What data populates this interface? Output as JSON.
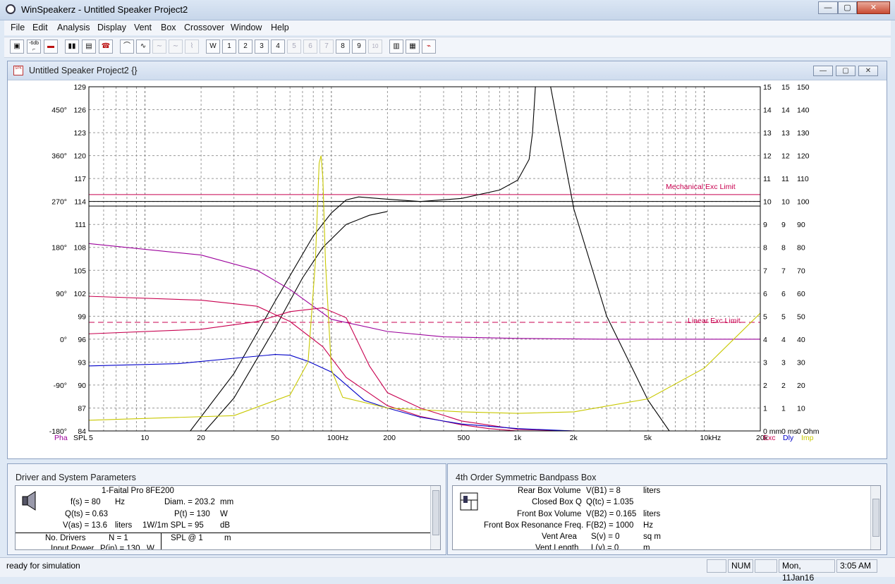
{
  "window": {
    "title": "WinSpeakerz - Untitled Speaker Project2",
    "min": "—",
    "max": "▢",
    "close": "✕"
  },
  "menu": [
    "File",
    "Edit",
    "Analysis",
    "Display",
    "Vent",
    "Box",
    "Crossover",
    "Window",
    "Help"
  ],
  "toolbar": {
    "b2": "-6db",
    "w": "W",
    "n1": "1",
    "n2": "2",
    "n3": "3",
    "n4": "4",
    "n5": "5",
    "n6": "6",
    "n7": "7",
    "n8": "8",
    "n9": "9",
    "n10": "10"
  },
  "icons": [
    "driver-icon",
    "step-icon",
    "car-icon",
    "bars-icon",
    "speaker-icon",
    "phone-icon",
    "curve1-icon",
    "curve2-icon",
    "curve3-icon",
    "curve4-icon",
    "curve5-icon",
    "graph-icon",
    "print-icon",
    "scope-icon"
  ],
  "child": {
    "title": "Untitled Speaker Project2 {}",
    "icon_text": "SPK",
    "min": "—",
    "max": "▢",
    "close": "✕"
  },
  "chart_data": {
    "type": "line",
    "x_scale": "log",
    "xlim": [
      5,
      20000
    ],
    "x_ticks": [
      "5",
      "10",
      "20",
      "50",
      "100Hz",
      "200",
      "500",
      "1k",
      "2k",
      "5k",
      "10kHz",
      "20k"
    ],
    "spl_ticks": [
      "129",
      "126",
      "123",
      "120",
      "117",
      "114",
      "111",
      "108",
      "105",
      "102",
      "99",
      "96",
      "93",
      "90",
      "87",
      "84"
    ],
    "phase_ticks": [
      "450°",
      "360°",
      "270°",
      "180°",
      "90°",
      "0°",
      "-90°",
      "-180°"
    ],
    "right_ticks_exc": [
      "15",
      "14",
      "13",
      "12",
      "11",
      "10",
      "9",
      "8",
      "7",
      "6",
      "5",
      "4",
      "3",
      "2",
      "1",
      "0 mm"
    ],
    "right_ticks_dly": [
      "15",
      "14",
      "13",
      "12",
      "11",
      "10",
      "9",
      "8",
      "7",
      "6",
      "5",
      "4",
      "3",
      "2",
      "1",
      "0 ms"
    ],
    "right_ticks_imp": [
      "150",
      "140",
      "130",
      "120",
      "110",
      "100",
      "90",
      "80",
      "70",
      "60",
      "50",
      "40",
      "30",
      "20",
      "10",
      "0 Ohm"
    ],
    "axis_labels": {
      "pha": "Pha",
      "spl": "SPL",
      "exc": "Exc",
      "dly": "Dly",
      "imp": "Imp"
    },
    "annotations": {
      "mech": "Mechanical Exc Limit",
      "lin": "Linear Exc Limit"
    },
    "colors": {
      "spl": "#000000",
      "pha": "#9b009b",
      "exc": "#c8004f",
      "dly": "#0000c8",
      "imp": "#c8c800",
      "limit": "#c8004f"
    },
    "series": [
      {
        "id": "spl_a",
        "color": "#000000",
        "x": [
          17.5,
          30,
          50,
          80,
          100,
          120,
          140,
          200,
          300,
          500,
          800,
          1000,
          1150,
          1200,
          1250,
          1300,
          1500,
          2000,
          3000,
          5000,
          6500
        ],
        "y": [
          84,
          91.5,
          101,
          109.5,
          112.5,
          114.2,
          114.6,
          114.3,
          114.0,
          114.4,
          115.5,
          116.8,
          119.5,
          123,
          130,
          133,
          129,
          113,
          99,
          88,
          84
        ]
      },
      {
        "id": "spl_b",
        "color": "#000000",
        "x": [
          21,
          30,
          50,
          70,
          90,
          120,
          160,
          200
        ],
        "y": [
          84,
          88.3,
          97.5,
          104,
          108,
          111,
          112.2,
          112.7
        ]
      },
      {
        "id": "phase",
        "color": "#9b009b",
        "x": [
          5,
          20,
          40,
          60,
          100,
          200,
          400,
          1000,
          3000,
          20000
        ],
        "y": [
          108.5,
          107,
          105,
          102.5,
          98.6,
          97,
          96.3,
          96.1,
          96,
          96
        ]
      },
      {
        "id": "exc",
        "color": "#c8004f",
        "x": [
          5,
          20,
          40,
          60,
          90,
          120,
          160,
          200,
          300,
          500,
          1000,
          2000
        ],
        "y": [
          96.7,
          97.3,
          98.3,
          99.6,
          100.1,
          98.8,
          92.5,
          89,
          87,
          85.3,
          84.2,
          84
        ]
      },
      {
        "id": "exc_b",
        "color": "#c8004f",
        "x": [
          5,
          20,
          40,
          60,
          90,
          120,
          200,
          300,
          500,
          700,
          1000
        ],
        "y": [
          101.6,
          101.1,
          100.3,
          98.3,
          95,
          91,
          87.3,
          85.9,
          84.8,
          84.3,
          84
        ]
      },
      {
        "id": "dly",
        "color": "#0000c8",
        "x": [
          5,
          15,
          30,
          50,
          60,
          75,
          100,
          150,
          200,
          300,
          500,
          1000,
          2000
        ],
        "y": [
          92.5,
          92.8,
          93.5,
          94.0,
          93.9,
          93.1,
          91.7,
          88,
          87,
          85.8,
          84.9,
          84.3,
          84
        ]
      },
      {
        "id": "imp",
        "color": "#c8c800",
        "x": [
          5,
          30,
          60,
          75,
          82,
          86,
          88,
          90,
          93,
          100,
          115,
          200,
          500,
          1000,
          2000,
          5000,
          10000,
          20000
        ],
        "y": [
          85.4,
          86.0,
          88.7,
          93,
          106,
          119,
          120,
          117,
          106,
          92,
          88.4,
          87.0,
          86.5,
          86.3,
          86.5,
          88.2,
          92.2,
          99.4
        ]
      }
    ],
    "hlines": [
      {
        "y": 114.0,
        "color": "#000000",
        "style": "solid",
        "x_to": 20000
      },
      {
        "y": 113.4,
        "color": "#000000",
        "style": "solid",
        "x_to": 20000
      },
      {
        "y": 114.9,
        "color": "#c8004f",
        "style": "solid",
        "x_to": 20000
      },
      {
        "y": 98.2,
        "color": "#c8004f",
        "style": "dashed",
        "x_to": 20000
      }
    ],
    "grid": true
  },
  "driver_panel": {
    "title": "Driver and System Parameters",
    "driver": "1-Faital Pro 8FE200",
    "rows": [
      {
        "a": "f(s) = 80",
        "b": "Hz",
        "c": "Diam. = 203.2",
        "d": "mm"
      },
      {
        "a": "Q(ts) = 0.63",
        "b": "",
        "c": "P(t) = 130",
        "d": "W"
      },
      {
        "a": "V(as) = 13.6",
        "b": "liters",
        "c": "1W/1m SPL = 95",
        "d": "dB"
      }
    ],
    "nd_label": "No. Drivers",
    "nd_value": "N = 1",
    "spl1": "SPL @ 1",
    "spl1_unit": "m",
    "ip_label": "Input Power",
    "ip_value": "P(in) = 130",
    "ip_unit": "W"
  },
  "box_panel": {
    "title": "4th Order Symmetric Bandpass Box",
    "rows": [
      {
        "a": "Rear Box Volume",
        "b": "V(B1) = 8",
        "c": "liters"
      },
      {
        "a": "Closed Box Q",
        "b": "Q(tc) = 1.035",
        "c": ""
      },
      {
        "a": "Front Box Volume",
        "b": "V(B2) = 0.165",
        "c": "liters"
      },
      {
        "a": "Front Box Resonance Freq.",
        "b": "F(B2) = 1000",
        "c": "Hz"
      },
      {
        "a": "Vent Area",
        "b": "S(v) = 0",
        "c": "sq m"
      },
      {
        "a": "Vent Length",
        "b": "L(v) = 0",
        "c": "m"
      }
    ]
  },
  "status": {
    "text": "ready for simulation",
    "num": "NUM",
    "date": "Mon, 11Jan16",
    "time": "3:05  AM"
  }
}
